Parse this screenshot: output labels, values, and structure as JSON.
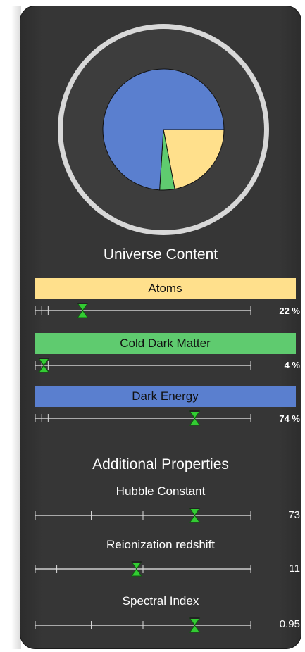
{
  "universe_content": {
    "title": "Universe Content",
    "pie": {
      "slices": [
        {
          "label": "Atoms",
          "percent": 22,
          "color": "#ffe08c"
        },
        {
          "label": "Cold Dark Matter",
          "percent": 4,
          "color": "#5fcb6f"
        },
        {
          "label": "Dark Energy",
          "percent": 74,
          "color": "#5a7fcf"
        }
      ]
    },
    "components": [
      {
        "name": "Atoms",
        "value_text": "22 %",
        "fraction": 0.22,
        "color": "#ffe08c"
      },
      {
        "name": "Cold Dark Matter",
        "value_text": "4 %",
        "fraction": 0.04,
        "color": "#5fcb6f"
      },
      {
        "name": "Dark Energy",
        "value_text": "74 %",
        "fraction": 0.74,
        "color": "#5a7fcf"
      }
    ]
  },
  "additional": {
    "title": "Additional Properties",
    "properties": [
      {
        "name": "Hubble Constant",
        "value_text": "73",
        "fraction": 0.74
      },
      {
        "name": "Reionization redshift",
        "value_text": "11",
        "fraction": 0.47
      },
      {
        "name": "Spectral Index",
        "value_text": "0.95",
        "fraction": 0.74
      }
    ]
  },
  "colors": {
    "panel": "#363636",
    "thumb": "#33cc33",
    "text": "#ffffff"
  }
}
